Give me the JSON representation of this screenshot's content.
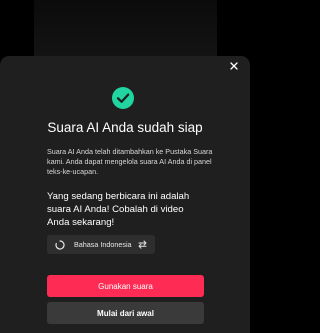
{
  "dialog": {
    "title": "Suara AI Anda sudah siap",
    "description": "Suara AI Anda telah ditambahkan ke Pustaka Suara kami. Anda dapat mengelola suara AI Anda di panel teks-ke-ucapan.",
    "headline": "Yang sedang berbicara ini adalah suara AI Anda! Cobalah di video Anda sekarang!",
    "voice_chip": {
      "label": "Bahasa Indonesia"
    },
    "primary_button": "Gunakan suara",
    "secondary_button": "Mulai dari awal"
  },
  "icons": {
    "close": "close-icon",
    "success": "check-circle-icon",
    "loading": "spinner-icon",
    "swap": "swap-icon"
  },
  "colors": {
    "accent": "#fe2c55",
    "success": "#20d5a0",
    "sheet_bg": "#1f1f1f",
    "secondary_button": "#3a3a3a"
  }
}
